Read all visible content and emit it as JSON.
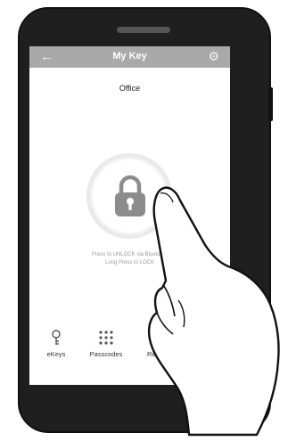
{
  "header": {
    "title": "My Key",
    "back_icon": "back-arrow-icon",
    "settings_icon": "gear-icon"
  },
  "lock": {
    "name": "Office",
    "hint_line1": "Press to UNLOCK via Bluetooth",
    "hint_line2": "Long Press to LOCK"
  },
  "tabs": [
    {
      "label": "eKeys",
      "icon": "key-icon"
    },
    {
      "label": "Passcodes",
      "icon": "keypad-icon"
    },
    {
      "label": "Records",
      "icon": "records-icon"
    }
  ],
  "colors": {
    "appbar": "#a9a9a9",
    "phone_body": "#1f1f1f",
    "lock_icon": "#8c8c8c"
  }
}
